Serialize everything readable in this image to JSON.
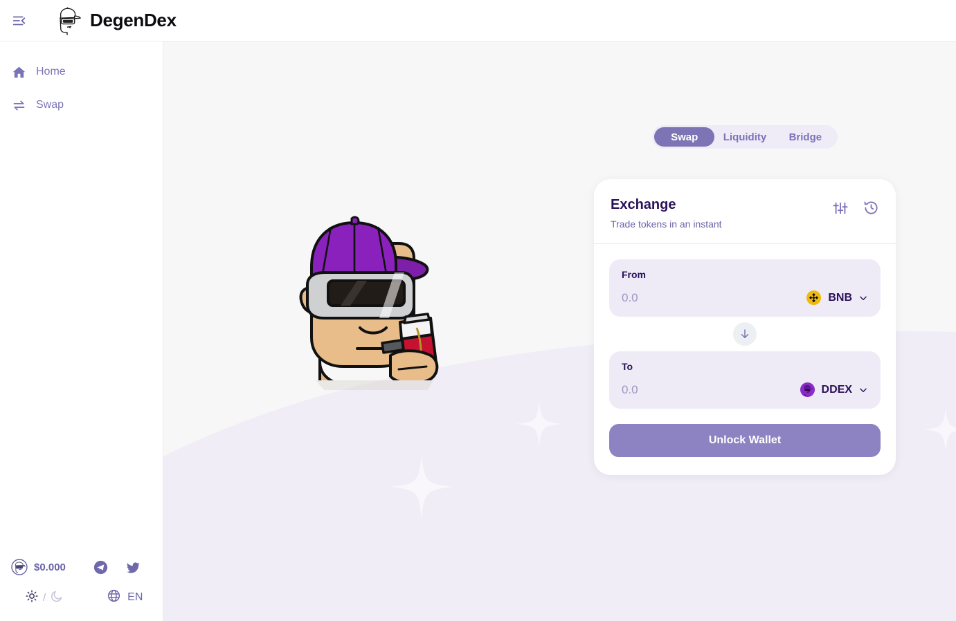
{
  "header": {
    "menu_icon": "collapse-menu-icon",
    "logo_icon": "degendex-mascot-logo",
    "title": "DegenDex"
  },
  "sidebar": {
    "items": [
      {
        "label": "Home",
        "icon": "home-icon"
      },
      {
        "label": "Swap",
        "icon": "swap-arrows-icon"
      }
    ],
    "footer": {
      "token_icon": "ddex-token-icon",
      "price": "$0.000",
      "socials": [
        {
          "name": "telegram-icon"
        },
        {
          "name": "twitter-icon"
        }
      ],
      "theme": {
        "light_icon": "sun-icon",
        "separator": "/",
        "dark_icon": "moon-icon",
        "active": "light"
      },
      "language": {
        "icon": "globe-icon",
        "label": "EN"
      }
    }
  },
  "main": {
    "illustration": "degen-mascot-illustration",
    "tabs": [
      {
        "label": "Swap",
        "active": true
      },
      {
        "label": "Liquidity",
        "active": false
      },
      {
        "label": "Bridge",
        "active": false
      }
    ],
    "card": {
      "title": "Exchange",
      "subtitle": "Trade tokens in an instant",
      "actions": [
        {
          "name": "settings-sliders-icon"
        },
        {
          "name": "transaction-history-icon"
        }
      ],
      "from": {
        "label": "From",
        "value": "",
        "placeholder": "0.0",
        "token": "BNB",
        "token_icon": "bnb-token-icon",
        "chevron": "chevron-down-icon"
      },
      "switch_icon": "arrow-down-icon",
      "to": {
        "label": "To",
        "value": "",
        "placeholder": "0.0",
        "token": "DDEX",
        "token_icon": "ddex-token-icon",
        "chevron": "chevron-down-icon"
      },
      "cta_label": "Unlock Wallet"
    }
  },
  "colors": {
    "accent": "#7d74b5",
    "accent_light": "#8d83c2",
    "title_dark": "#2b1159",
    "muted": "#6a64a8",
    "field_bg": "#eeebf6",
    "bnb_gold": "#f0b90b",
    "ddex_purple": "#8b2bc9",
    "page_bg": "#f7f7f8"
  }
}
